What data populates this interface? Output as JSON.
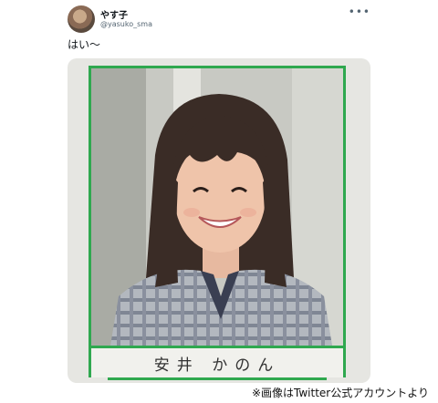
{
  "tweet": {
    "display_name": "やす子",
    "handle": "@yasuko_sma",
    "text": "はい〜",
    "more_icon": "more-horizontal-icon"
  },
  "media": {
    "student_name": "安井 かのん",
    "frame_color": "#2fa84f"
  },
  "credit": "※画像はTwitter公式アカウントより"
}
